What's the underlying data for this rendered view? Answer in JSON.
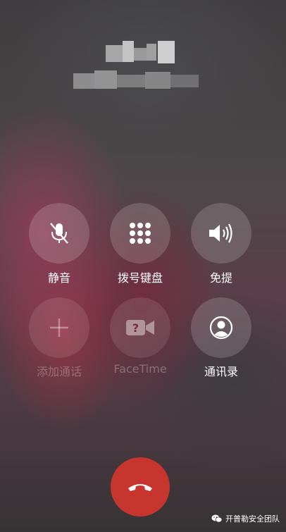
{
  "call_controls": [
    {
      "label": "静音",
      "icon": "mic-off-icon",
      "enabled": true
    },
    {
      "label": "拨号键盘",
      "icon": "keypad-icon",
      "enabled": true
    },
    {
      "label": "免提",
      "icon": "speaker-icon",
      "enabled": true
    },
    {
      "label": "添加通话",
      "icon": "plus-icon",
      "enabled": false
    },
    {
      "label": "FaceTime",
      "icon": "facetime-unknown-icon",
      "enabled": false
    },
    {
      "label": "通讯录",
      "icon": "contact-icon",
      "enabled": true
    }
  ],
  "end_call": {
    "icon": "phone-hangup-icon",
    "color": "#c7352f"
  },
  "watermark": {
    "text": "开普勒安全团队",
    "icon": "wechat-icon"
  },
  "colors": {
    "label": "#ffffff",
    "label_disabled": "#5c5457",
    "end_call": "#c7352f"
  }
}
